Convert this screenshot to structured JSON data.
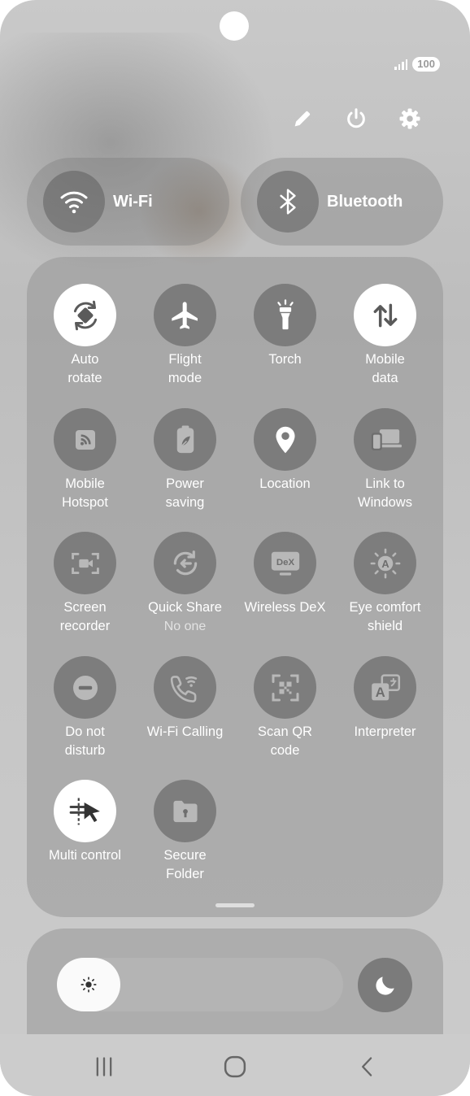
{
  "status": {
    "battery": "100"
  },
  "pills": {
    "wifi": "Wi-Fi",
    "bluetooth": "Bluetooth"
  },
  "tiles": [
    {
      "label1": "Auto",
      "label2": "rotate",
      "icon": "auto-rotate-icon",
      "on": true
    },
    {
      "label1": "Flight",
      "label2": "mode",
      "icon": "airplane-icon",
      "on": false
    },
    {
      "label1": "Torch",
      "label2": "",
      "icon": "torch-icon",
      "on": false
    },
    {
      "label1": "Mobile",
      "label2": "data",
      "icon": "mobile-data-icon",
      "on": true
    },
    {
      "label1": "Mobile",
      "label2": "Hotspot",
      "icon": "hotspot-icon",
      "on": false
    },
    {
      "label1": "Power",
      "label2": "saving",
      "icon": "power-saving-icon",
      "on": false
    },
    {
      "label1": "Location",
      "label2": "",
      "icon": "location-icon",
      "on": false
    },
    {
      "label1": "Link to",
      "label2": "Windows",
      "icon": "link-to-windows-icon",
      "on": false
    },
    {
      "label1": "Screen",
      "label2": "recorder",
      "icon": "screen-recorder-icon",
      "on": false
    },
    {
      "label1": "Quick Share",
      "label2": "",
      "sub": "No one",
      "icon": "quick-share-icon",
      "on": false
    },
    {
      "label1": "Wireless DeX",
      "label2": "",
      "icon": "dex-icon",
      "on": false
    },
    {
      "label1": "Eye comfort",
      "label2": "shield",
      "icon": "eye-comfort-icon",
      "on": false
    },
    {
      "label1": "Do not",
      "label2": "disturb",
      "icon": "do-not-disturb-icon",
      "on": false
    },
    {
      "label1": "Wi-Fi Calling",
      "label2": "",
      "icon": "wifi-calling-icon",
      "on": false
    },
    {
      "label1": "Scan QR",
      "label2": "code",
      "icon": "qr-scan-icon",
      "on": false
    },
    {
      "label1": "Interpreter",
      "label2": "",
      "icon": "interpreter-icon",
      "on": false
    },
    {
      "label1": "Multi control",
      "label2": "",
      "icon": "multi-control-icon",
      "on": true
    },
    {
      "label1": "Secure",
      "label2": "Folder",
      "icon": "secure-folder-icon",
      "on": false
    }
  ],
  "icons": {
    "dex_text": "DeX",
    "eye_letter": "A",
    "interp_letter": "A"
  },
  "brightness": {
    "level": 0.0
  }
}
